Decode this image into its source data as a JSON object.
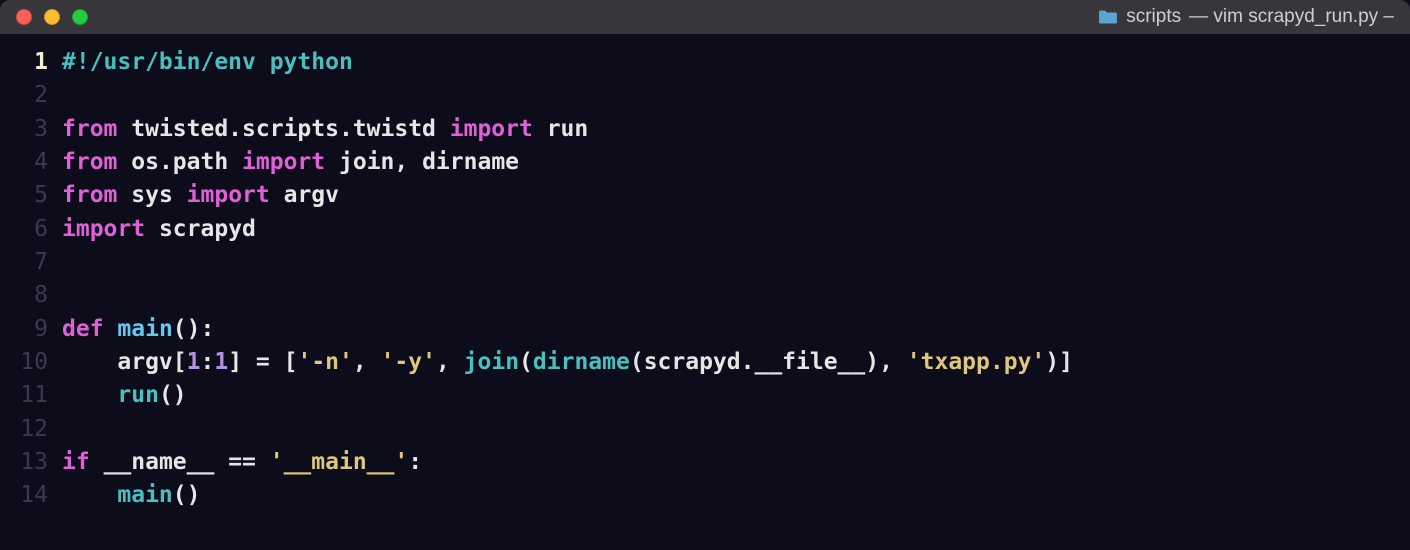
{
  "window": {
    "folder": "scripts",
    "title_suffix": "— vim scrapyd_run.py –"
  },
  "editor": {
    "current_line": 1,
    "lines": [
      {
        "num": 1,
        "tokens": [
          {
            "t": "#!/usr/bin/env python",
            "c": "c"
          }
        ]
      },
      {
        "num": 2,
        "tokens": []
      },
      {
        "num": 3,
        "tokens": [
          {
            "t": "from",
            "c": "k"
          },
          {
            "t": " "
          },
          {
            "t": "twisted.scripts.twistd",
            "c": "id"
          },
          {
            "t": " "
          },
          {
            "t": "import",
            "c": "k"
          },
          {
            "t": " "
          },
          {
            "t": "run",
            "c": "id"
          }
        ]
      },
      {
        "num": 4,
        "tokens": [
          {
            "t": "from",
            "c": "k"
          },
          {
            "t": " "
          },
          {
            "t": "os.path",
            "c": "id"
          },
          {
            "t": " "
          },
          {
            "t": "import",
            "c": "k"
          },
          {
            "t": " "
          },
          {
            "t": "join, dirname",
            "c": "id"
          }
        ]
      },
      {
        "num": 5,
        "tokens": [
          {
            "t": "from",
            "c": "k"
          },
          {
            "t": " "
          },
          {
            "t": "sys",
            "c": "id"
          },
          {
            "t": " "
          },
          {
            "t": "import",
            "c": "k"
          },
          {
            "t": " "
          },
          {
            "t": "argv",
            "c": "id"
          }
        ]
      },
      {
        "num": 6,
        "tokens": [
          {
            "t": "import",
            "c": "k"
          },
          {
            "t": " "
          },
          {
            "t": "scrapyd",
            "c": "id"
          }
        ]
      },
      {
        "num": 7,
        "tokens": []
      },
      {
        "num": 8,
        "tokens": []
      },
      {
        "num": 9,
        "tokens": [
          {
            "t": "def",
            "c": "k"
          },
          {
            "t": " "
          },
          {
            "t": "main",
            "c": "fn"
          },
          {
            "t": "():",
            "c": "p"
          }
        ]
      },
      {
        "num": 10,
        "tokens": [
          {
            "t": "    "
          },
          {
            "t": "argv",
            "c": "id"
          },
          {
            "t": "[",
            "c": "p"
          },
          {
            "t": "1",
            "c": "n"
          },
          {
            "t": ":",
            "c": "p"
          },
          {
            "t": "1",
            "c": "n"
          },
          {
            "t": "] = [",
            "c": "p"
          },
          {
            "t": "'-n'",
            "c": "s"
          },
          {
            "t": ", ",
            "c": "p"
          },
          {
            "t": "'-y'",
            "c": "s"
          },
          {
            "t": ", ",
            "c": "p"
          },
          {
            "t": "join",
            "c": "call"
          },
          {
            "t": "(",
            "c": "p"
          },
          {
            "t": "dirname",
            "c": "call"
          },
          {
            "t": "(scrapyd.",
            "c": "p"
          },
          {
            "t": "__file__",
            "c": "dunder"
          },
          {
            "t": "), ",
            "c": "p"
          },
          {
            "t": "'txapp.py'",
            "c": "s"
          },
          {
            "t": ")]",
            "c": "p"
          }
        ]
      },
      {
        "num": 11,
        "tokens": [
          {
            "t": "    "
          },
          {
            "t": "run",
            "c": "call"
          },
          {
            "t": "()",
            "c": "p"
          }
        ]
      },
      {
        "num": 12,
        "tokens": []
      },
      {
        "num": 13,
        "tokens": [
          {
            "t": "if",
            "c": "k"
          },
          {
            "t": " "
          },
          {
            "t": "__name__",
            "c": "dunder"
          },
          {
            "t": " == ",
            "c": "p"
          },
          {
            "t": "'__main__'",
            "c": "s"
          },
          {
            "t": ":",
            "c": "p"
          }
        ]
      },
      {
        "num": 14,
        "tokens": [
          {
            "t": "    "
          },
          {
            "t": "main",
            "c": "call"
          },
          {
            "t": "()",
            "c": "p"
          }
        ]
      }
    ]
  }
}
